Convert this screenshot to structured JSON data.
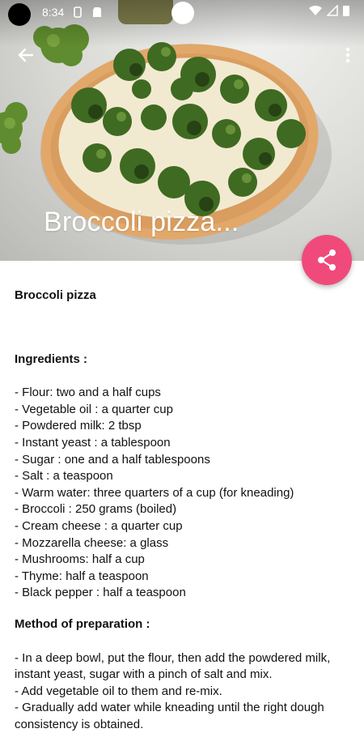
{
  "status_bar": {
    "time": "8:34"
  },
  "hero": {
    "title": "Broccoli pizza..."
  },
  "recipe": {
    "title": "Broccoli pizza",
    "ingredients_heading": "Ingredients :",
    "ingredients": [
      "- Flour: two and a half cups",
      "- Vegetable oil : a quarter cup",
      "- Powdered milk: 2 tbsp",
      "- Instant yeast : a tablespoon",
      "- Sugar : one and a half tablespoons",
      "- Salt : a teaspoon",
      "- Warm water: three quarters of a cup (for kneading)",
      "- Broccoli : 250 grams (boiled)",
      "- Cream cheese : a quarter cup",
      "- Mozzarella cheese: a glass",
      "- Mushrooms: half a cup",
      "- Thyme: half a teaspoon",
      "- Black pepper : half a teaspoon"
    ],
    "method_heading": "Method of preparation :",
    "method_steps": [
      "- In a deep bowl, put the flour, then add the powdered milk, instant yeast, sugar with a pinch of salt and mix.",
      "- Add vegetable oil to them and re-mix.",
      "- Gradually add water while kneading until the right dough consistency is obtained."
    ]
  },
  "colors": {
    "accent": "#f04a7b",
    "crust": "#e2a86a",
    "broccoli": "#3f6a22"
  },
  "icons": {
    "back": "arrow-left-icon",
    "menu": "more-vert-icon",
    "share": "share-icon"
  }
}
